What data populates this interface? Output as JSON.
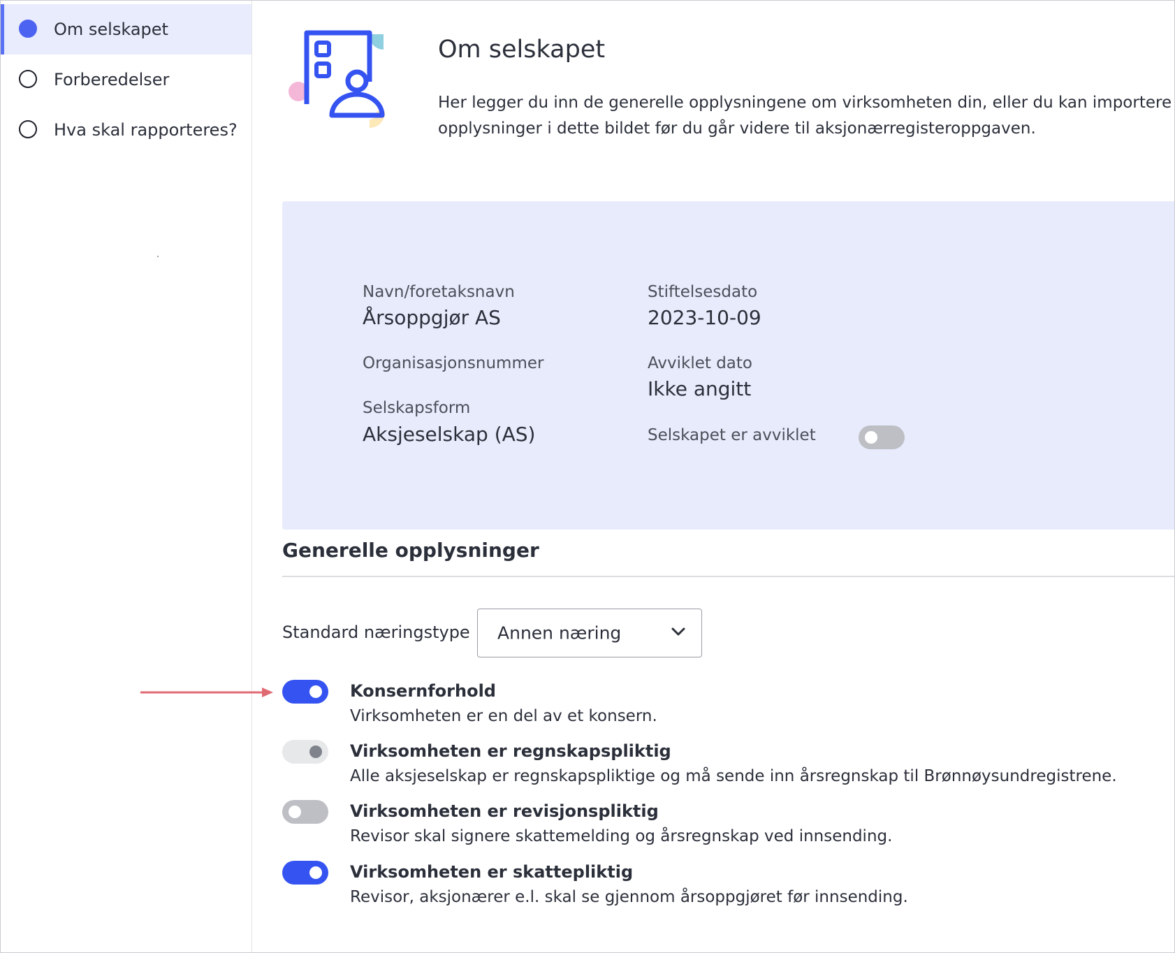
{
  "sidebar": {
    "items": [
      {
        "label": "Om selskapet"
      },
      {
        "label": "Forberedelser"
      },
      {
        "label": "Hva skal rapporteres?"
      }
    ]
  },
  "header": {
    "title": "Om selskapet",
    "intro": "Her legger du inn de generelle opplysningene om virksomheten din, eller du kan importere\nopplysninger i dette bildet før du går videre til aksjonærregisteroppgaven."
  },
  "company": {
    "name_label": "Navn/foretaksnavn",
    "name_value": "Årsoppgjør AS",
    "orgnr_label": "Organisasjonsnummer",
    "form_label": "Selskapsform",
    "form_value": "Aksjeselskap (AS)",
    "founded_label": "Stiftelsesdato",
    "founded_value": "2023-10-09",
    "dissolved_label": "Avviklet dato",
    "dissolved_value": "Ikke angitt",
    "dissolved_toggle_label": "Selskapet er avviklet"
  },
  "general": {
    "heading": "Generelle opplysninger",
    "industry_label": "Standard næringstype",
    "industry_value": "Annen næring",
    "options": [
      {
        "title": "Konsernforhold",
        "desc": "Virksomheten er en del av et konsern."
      },
      {
        "title": "Virksomheten er regnskapspliktig",
        "desc": "Alle aksjeselskap er regnskapspliktige og må sende inn årsregnskap til Brønnøysundregistrene."
      },
      {
        "title": "Virksomheten er revisjonspliktig",
        "desc": "Revisor skal signere skattemelding og årsregnskap ved innsending."
      },
      {
        "title": "Virksomheten er skattepliktig",
        "desc": "Revisor, aksjonærer e.l. skal se gjennom årsoppgjøret før innsending."
      }
    ]
  },
  "colors": {
    "accent": "#3553f0",
    "panel": "#e8ebfb",
    "arrow": "#e06a73"
  }
}
